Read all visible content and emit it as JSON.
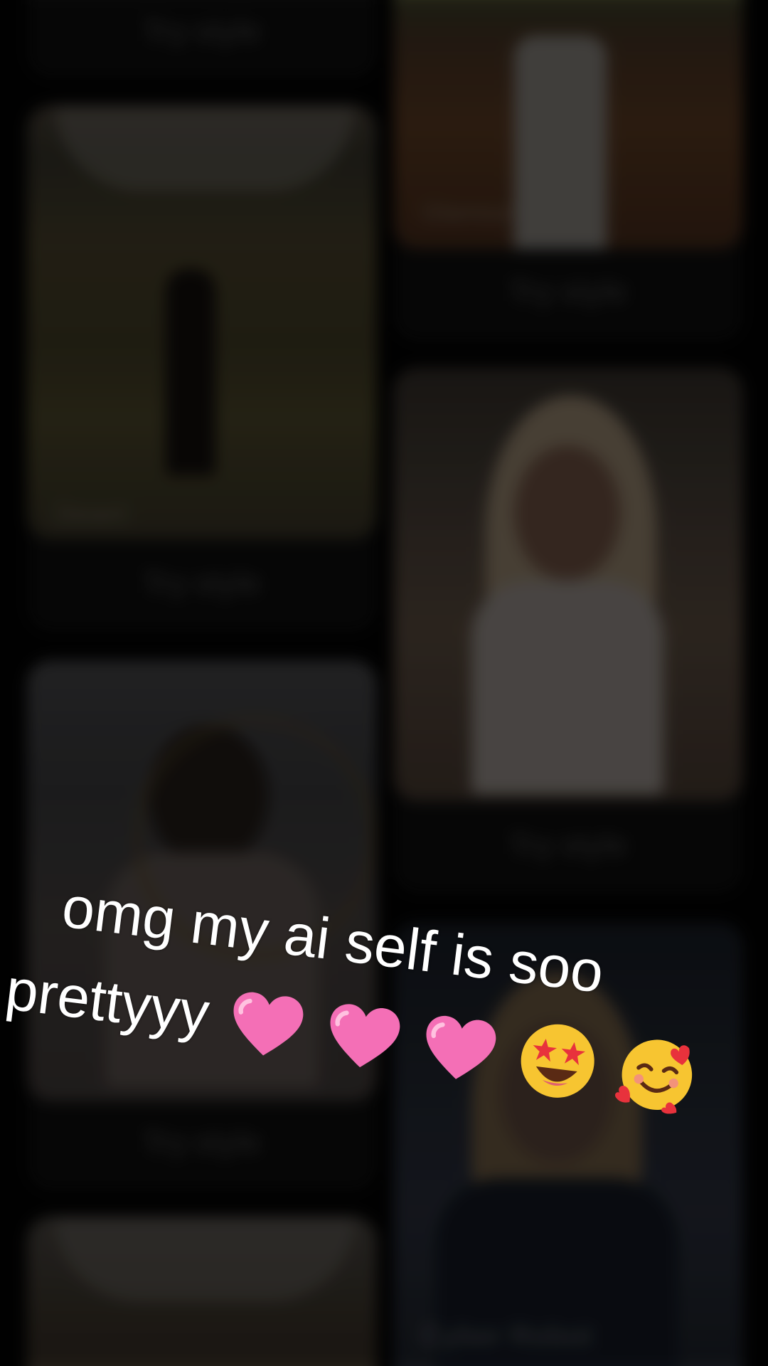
{
  "feed": {
    "cards": [
      {
        "column": "left",
        "try_label": "Try style",
        "photo_caption": ""
      },
      {
        "column": "left",
        "try_label": "Try style",
        "photo_caption": "Desert"
      },
      {
        "column": "left",
        "try_label": "Try style",
        "photo_caption": ""
      },
      {
        "column": "left",
        "try_label": "",
        "photo_caption": ""
      },
      {
        "column": "right",
        "try_label": "Try style",
        "photo_caption": "Glamour"
      },
      {
        "column": "right",
        "try_label": "Try style",
        "photo_caption": ""
      },
      {
        "column": "right",
        "try_label": "",
        "photo_caption": "Cyber Robot"
      }
    ]
  },
  "overlay_caption": {
    "line1": "omg my ai self is soo",
    "line2": "prettyyy",
    "emojis": [
      "pink-heart",
      "pink-heart",
      "pink-heart",
      "star-struck-face",
      "smiling-face-with-hearts"
    ]
  },
  "colors": {
    "background": "#020202",
    "card": "#0b0b0b",
    "caption_text": "#ffffff",
    "heart_pink": "#f46fb6",
    "emoji_yellow": "#f7c531"
  }
}
